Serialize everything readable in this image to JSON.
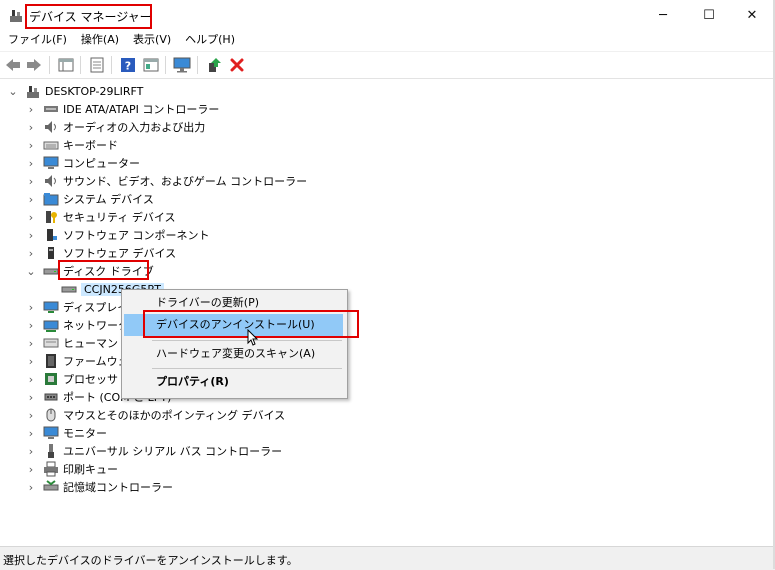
{
  "window": {
    "title": "デバイス マネージャー"
  },
  "window_controls": {
    "minimize": "─",
    "maximize": "☐",
    "close": "✕"
  },
  "menu": [
    "ファイル(F)",
    "操作(A)",
    "表示(V)",
    "ヘルプ(H)"
  ],
  "tree": {
    "root": "DESKTOP-29LIRFT",
    "categories": [
      "IDE ATA/ATAPI コントローラー",
      "オーディオの入力および出力",
      "キーボード",
      "コンピューター",
      "サウンド、ビデオ、およびゲーム コントローラー",
      "システム デバイス",
      "セキュリティ デバイス",
      "ソフトウェア コンポーネント",
      "ソフトウェア デバイス",
      "ディスク ドライブ",
      "ディスプレイ",
      "ネットワーク",
      "ヒューマン イ",
      "ファームウェア",
      "プロセッサ",
      "ポート (COM と LPT)",
      "マウスとそのほかのポインティング デバイス",
      "モニター",
      "ユニバーサル シリアル バス コントローラー",
      "印刷キュー",
      "記憶域コントローラー"
    ],
    "expanded_device": "CCJN256G5RT"
  },
  "context_menu": {
    "update_driver": "ドライバーの更新(P)",
    "uninstall_device": "デバイスのアンインストール(U)",
    "scan_hardware": "ハードウェア変更のスキャン(A)",
    "properties": "プロパティ(R)"
  },
  "status": {
    "text": "選択したデバイスのドライバーをアンインストールします。"
  },
  "colors": {
    "highlight_box": "#e00000",
    "menu_hover": "#91c9f7",
    "selection": "#cce8ff"
  }
}
